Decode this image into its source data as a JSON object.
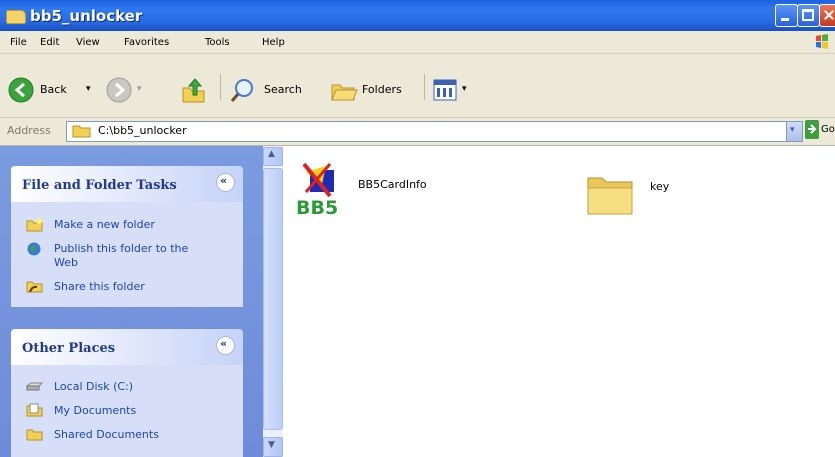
{
  "window": {
    "title": "bb5_unlocker"
  },
  "menu": [
    "File",
    "Edit",
    "View",
    "Favorites",
    "Tools",
    "Help"
  ],
  "toolbar": {
    "back": "Back",
    "search": "Search",
    "folders": "Folders"
  },
  "address": {
    "label": "Address",
    "path": "C:\\bb5_unlocker",
    "go": "Go"
  },
  "tasks_panel": {
    "title": "File and Folder Tasks",
    "items": [
      "Make a new folder",
      "Publish this folder to the Web",
      "Share this folder"
    ]
  },
  "places_panel": {
    "title": "Other Places",
    "items": [
      "Local Disk (C:)",
      "My Documents",
      "Shared Documents"
    ]
  },
  "files": [
    {
      "name": "BB5CardInfo",
      "icon": "bb5-app-icon"
    },
    {
      "name": "key",
      "icon": "folder-icon"
    }
  ]
}
